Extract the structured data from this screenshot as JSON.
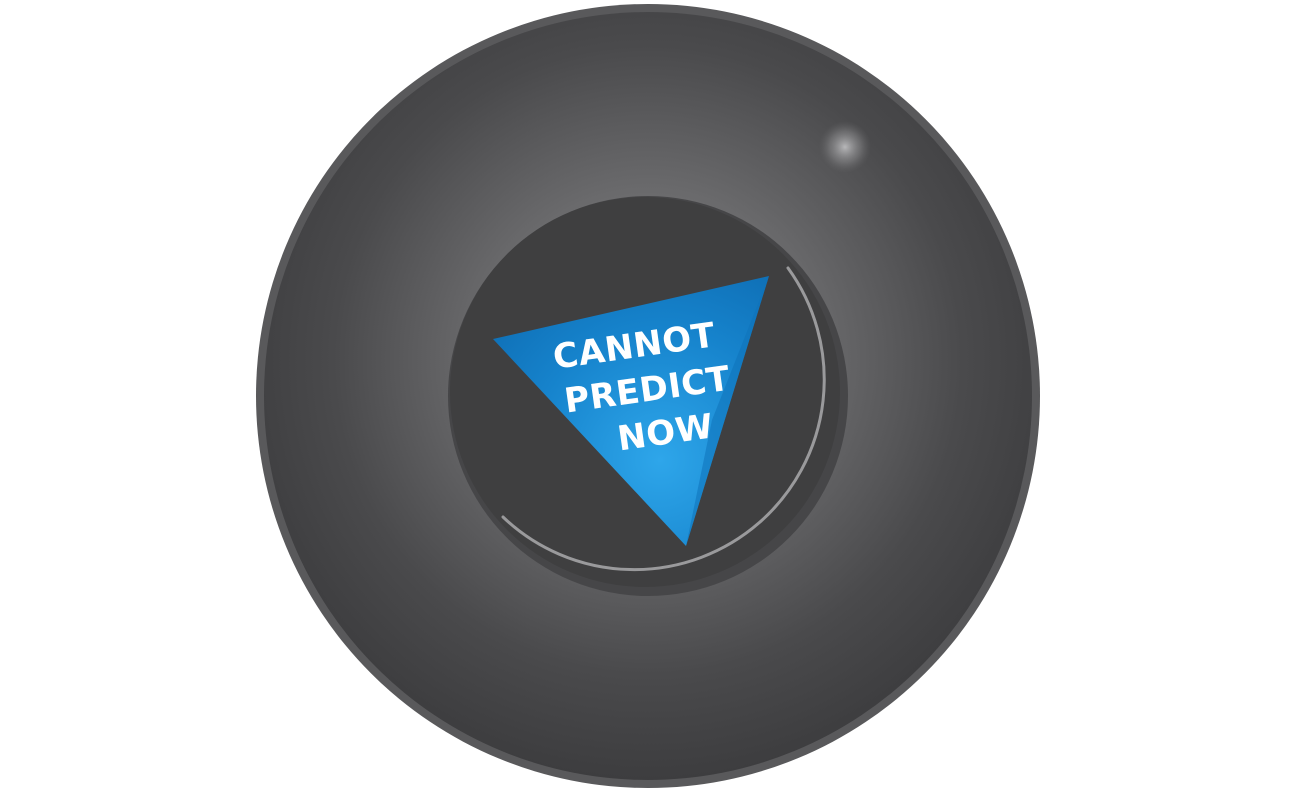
{
  "magic_ball": {
    "answer_lines": [
      "CANNOT",
      "PREDICT",
      "NOW"
    ]
  },
  "colors": {
    "background": "#ffffff",
    "ball_rim": "#59595b",
    "ball_highlight_center": "#8c8c8f",
    "ball_body_edge": "#404042",
    "window_fill": "#3f3f40",
    "window_ring": "#9a9a9c",
    "die_blue_light": "#2c9ee4",
    "die_blue_dark": "#0e6fb6",
    "answer_text": "#ffffff"
  },
  "icons": {
    "ball": "magic-8-ball-icon",
    "die": "answer-die-triangle-icon",
    "glare": "glare-highlight-icon"
  }
}
